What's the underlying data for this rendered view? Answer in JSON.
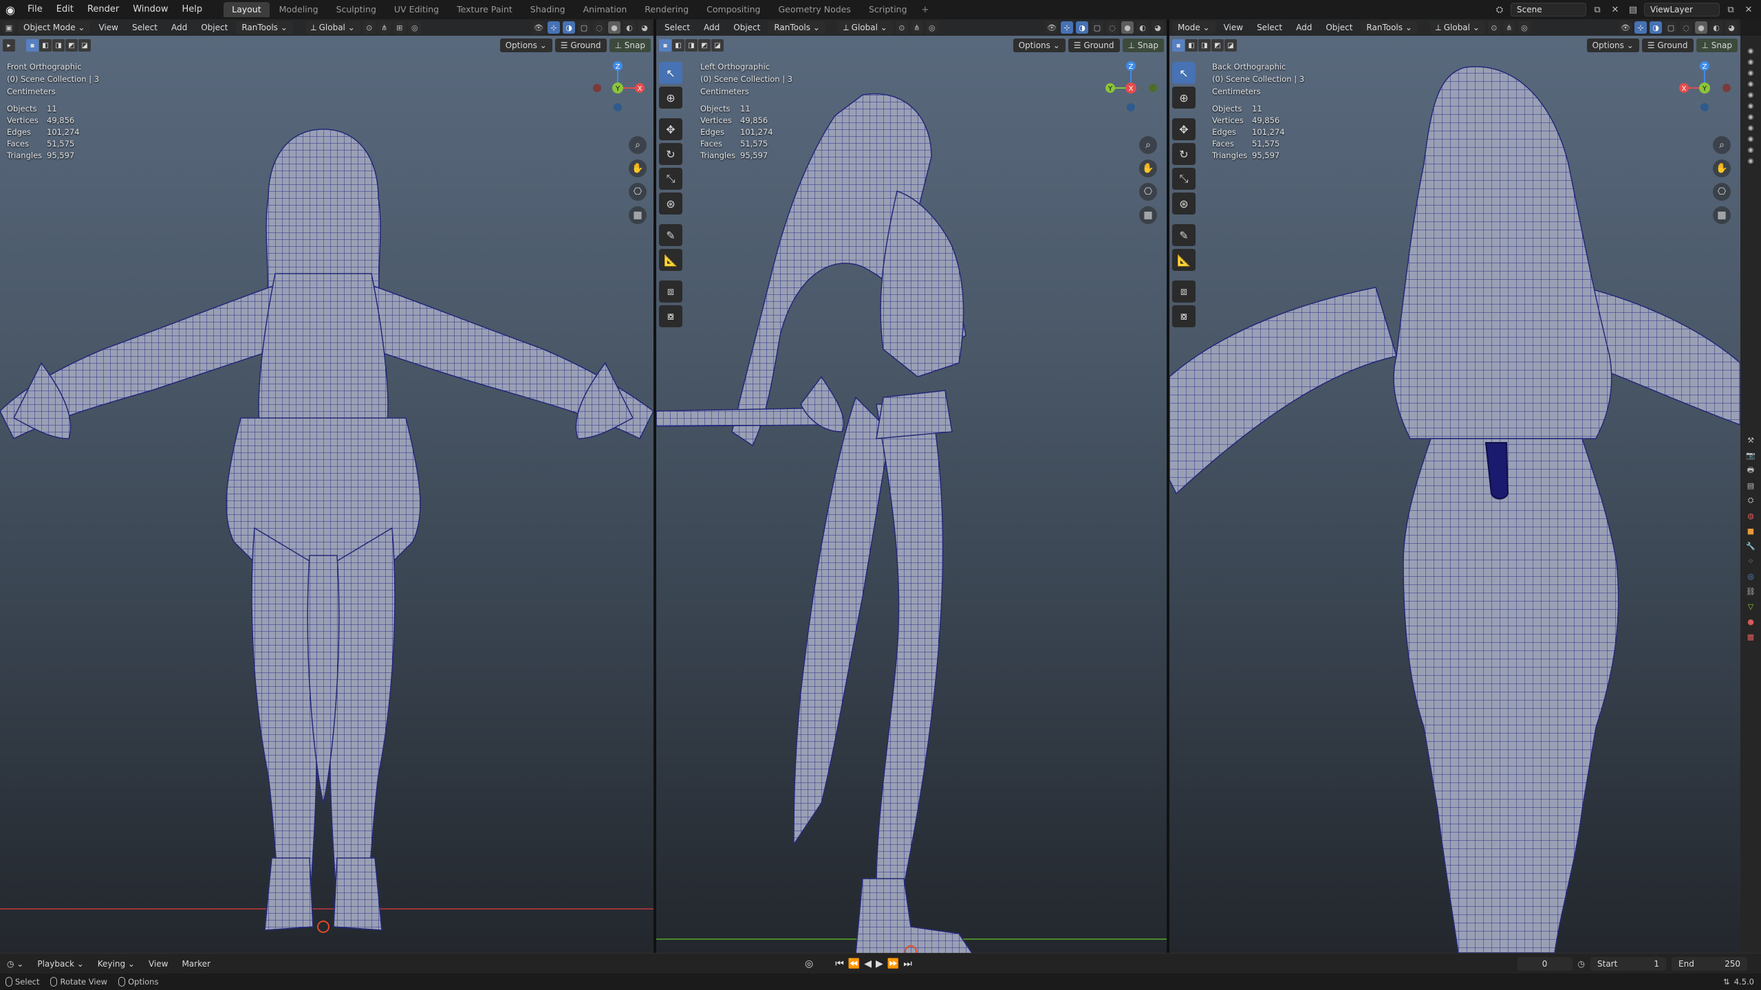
{
  "topbar": {
    "menus": [
      "File",
      "Edit",
      "Render",
      "Window",
      "Help"
    ],
    "workspaces": [
      "Layout",
      "Modeling",
      "Sculpting",
      "UV Editing",
      "Texture Paint",
      "Shading",
      "Animation",
      "Rendering",
      "Compositing",
      "Geometry Nodes",
      "Scripting"
    ],
    "active_workspace": "Layout",
    "scene": "Scene",
    "view_layer": "ViewLayer"
  },
  "viewports": {
    "left": {
      "header": {
        "mode": "Object Mode",
        "view": "View",
        "select": "Select",
        "add": "Add",
        "object": "Object",
        "addon": "RanTools",
        "orientation": "Global"
      },
      "options": "Options",
      "ground": "Ground",
      "snap": "Snap",
      "view_name": "Front Orthographic",
      "collection": "(0) Scene Collection | 3",
      "units": "Centimeters",
      "gizmo": {
        "up": "Z",
        "center": "Y",
        "right": "X"
      }
    },
    "middle": {
      "header": {
        "select": "Select",
        "add": "Add",
        "object": "Object",
        "addon": "RanTools",
        "orientation": "Global"
      },
      "options": "Options",
      "ground": "Ground",
      "snap": "Snap",
      "view_name": "Left Orthographic",
      "collection": "(0) Scene Collection | 3",
      "units": "Centimeters",
      "gizmo": {
        "up": "Z",
        "left": "Y",
        "center": "X"
      }
    },
    "right": {
      "header": {
        "mode": "Mode",
        "view": "View",
        "select": "Select",
        "add": "Add",
        "object": "Object",
        "addon": "RanTools",
        "orientation": "Global"
      },
      "options": "Options",
      "ground": "Ground",
      "snap": "Snap",
      "view_name": "Back Orthographic",
      "collection": "(0) Scene Collection | 3",
      "units": "Centimeters",
      "gizmo": {
        "up": "Z",
        "left": "X",
        "center": "Y"
      }
    }
  },
  "stats": {
    "labels": {
      "objects": "Objects",
      "vertices": "Vertices",
      "edges": "Edges",
      "faces": "Faces",
      "triangles": "Triangles"
    },
    "objects": "11",
    "vertices": "49,856",
    "edges": "101,274",
    "faces": "51,575",
    "triangles": "95,597"
  },
  "timeline": {
    "menus": [
      "Playback",
      "Keying",
      "View",
      "Marker"
    ],
    "current_frame": "0",
    "start_label": "Start",
    "start": "1",
    "end_label": "End",
    "end": "250"
  },
  "statusbar": {
    "select": "Select",
    "rotate": "Rotate View",
    "options": "Options",
    "version": "4.5.0"
  },
  "colors": {
    "accent": "#4772b3",
    "wire": "#2a2f8a",
    "x_axis": "#e74c4c",
    "y_axis": "#8bc53a",
    "z_axis": "#3f8be8"
  }
}
